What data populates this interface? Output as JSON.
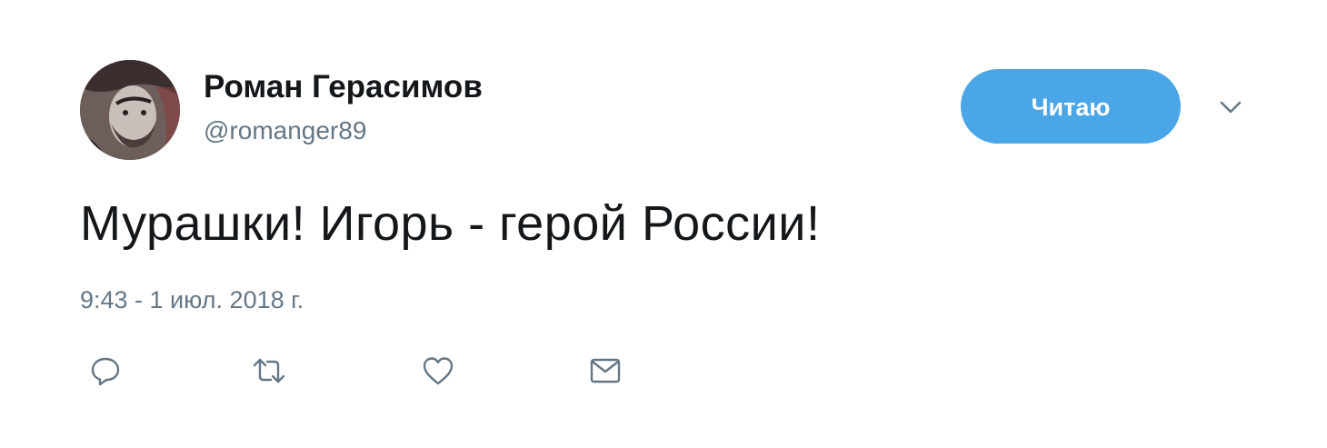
{
  "user": {
    "name": "Роман Герасимов",
    "handle": "@romanger89"
  },
  "follow_button": {
    "label": "Читаю"
  },
  "tweet": {
    "text": "Мурашки! Игорь - герой России!",
    "timestamp": "9:43 - 1 июл. 2018 г."
  },
  "actions": [
    {
      "icon": "reply-icon"
    },
    {
      "icon": "retweet-icon"
    },
    {
      "icon": "like-icon"
    },
    {
      "icon": "message-icon"
    }
  ],
  "colors": {
    "accent": "#4aa6e6",
    "text": "#14171a",
    "muted": "#657786",
    "icon": "#657786"
  }
}
